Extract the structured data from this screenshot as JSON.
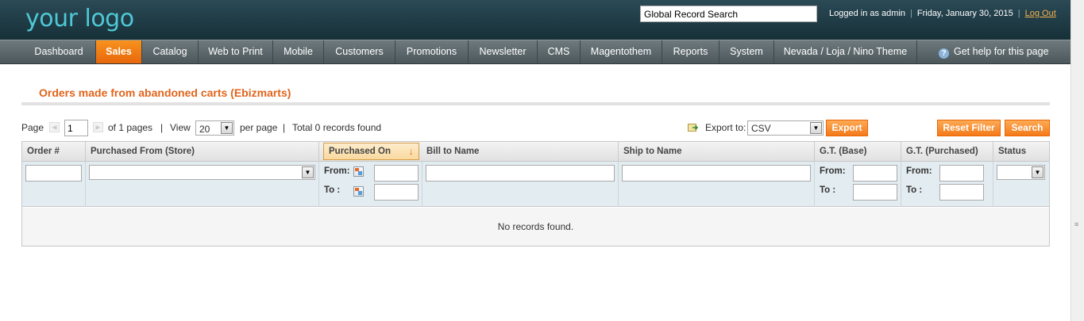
{
  "header": {
    "logo": "your logo",
    "search_value": "Global Record Search",
    "logged_in": "Logged in as admin",
    "date": "Friday, January 30, 2015",
    "logout": "Log Out"
  },
  "nav": {
    "items": [
      "Dashboard",
      "Sales",
      "Catalog",
      "Web to Print",
      "Mobile",
      "Customers",
      "Promotions",
      "Newsletter",
      "CMS",
      "Magentothem",
      "Reports",
      "System",
      "Nevada / Loja / Nino Theme"
    ],
    "active": "Sales",
    "help": "Get help for this page"
  },
  "page": {
    "title": "Orders made from abandoned carts (Ebizmarts)"
  },
  "pager": {
    "page_label": "Page",
    "page_value": "1",
    "of_pages": "of 1 pages",
    "sep": "|",
    "view_label": "View",
    "per_page_value": "20",
    "per_page_label": "per page",
    "total": "Total 0 records found"
  },
  "export": {
    "label": "Export to:",
    "format": "CSV",
    "button": "Export"
  },
  "actions": {
    "reset": "Reset Filter",
    "search": "Search"
  },
  "grid": {
    "columns": [
      "Order #",
      "Purchased From (Store)",
      "Purchased On",
      "Bill to Name",
      "Ship to Name",
      "G.T. (Base)",
      "G.T. (Purchased)",
      "Status"
    ],
    "from_label": "From:",
    "to_label": "To :",
    "empty": "No records found."
  },
  "colors": {
    "accent": "#e1641b",
    "header_bg": "#1f3c45",
    "nav_bg": "#5b676b"
  }
}
